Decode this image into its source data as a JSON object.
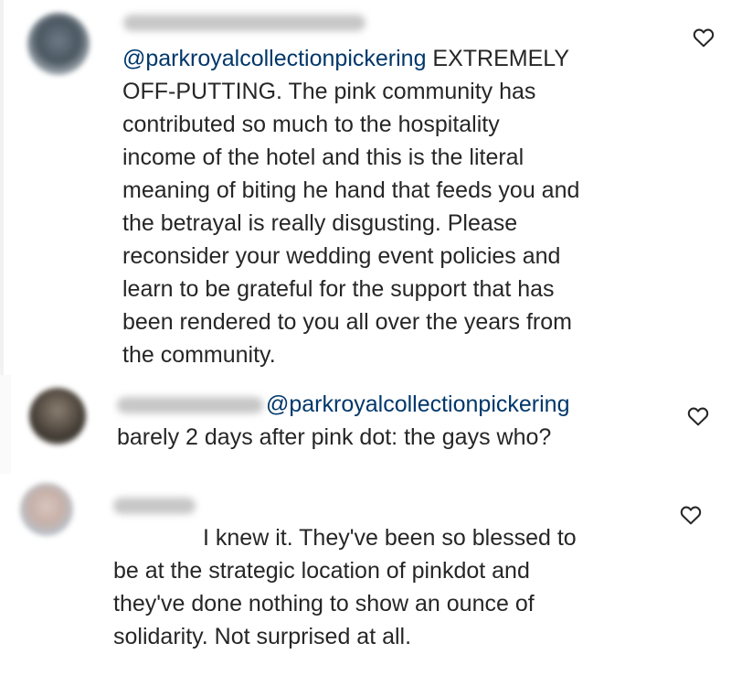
{
  "comments": [
    {
      "mention": "@parkroyalcollectionpickering",
      "text_after_mention": " EXTREMELY\nOFF-PUTTING. The pink community has\ncontributed so much to the hospitality\nincome of the hotel and this is the literal\nmeaning of biting he hand that feeds you and\nthe betrayal is really disgusting. Please\nreconsider your wedding event policies and\nlearn to be grateful for the support that has\nbeen rendered to you all over the years from\nthe community.",
      "like_icon": "heart-outline-icon"
    },
    {
      "mention": "@parkroyalcollectionpickering",
      "text_after_mention": "barely 2 days after pink dot: the gays who?",
      "like_icon": "heart-outline-icon"
    },
    {
      "mention": "",
      "text_after_mention": "I knew it. They've been so blessed to\nbe at the strategic location of pinkdot and\nthey've done nothing to show an ounce of\nsolidarity. Not surprised at all.",
      "like_icon": "heart-outline-icon"
    }
  ],
  "colors": {
    "mention": "#00376b",
    "text": "#262626",
    "icon": "#262626"
  }
}
